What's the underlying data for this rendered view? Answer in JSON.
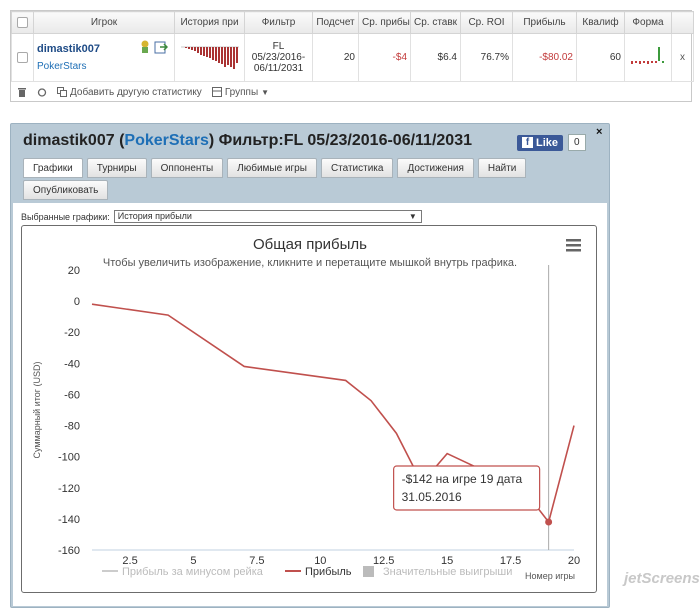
{
  "table": {
    "headers": [
      "Игрок",
      "История при",
      "Фильтр",
      "Подсчет",
      "Ср. прибы",
      "Ср. ставк",
      "Ср. ROI",
      "Прибыль",
      "Квалиф",
      "Форма"
    ],
    "row": {
      "player": "dimastik007",
      "site": "PokerStars",
      "filter_line1": "FL",
      "filter_line2": "05/23/2016-",
      "filter_line3": "06/11/2031",
      "count": "20",
      "avg_profit": "-$4",
      "avg_stake": "$6.4",
      "avg_roi": "76.7%",
      "profit": "-$80.02",
      "qualif": "60",
      "remove": "x"
    },
    "toolbar": {
      "add_stat": "Добавить другую статистику",
      "groups": "Группы"
    }
  },
  "profile": {
    "name": "dimastik007",
    "open_paren": "(",
    "site": "PokerStars",
    "filter": ") Фильтр:FL 05/23/2016-06/11/2031",
    "like_label": "Like",
    "like_count": "0",
    "close": "×",
    "tabs_row1": [
      "Графики",
      "Турниры",
      "Оппоненты",
      "Любимые игры",
      "Статистика",
      "Достижения",
      "Найти"
    ],
    "tabs_row2": [
      "Опубликовать"
    ],
    "chart_select_label": "Выбранные графики:",
    "chart_select_value": "История прибыли"
  },
  "chart_data": {
    "type": "line",
    "title": "Общая прибыль",
    "subtitle": "Чтобы увеличить изображение, кликните и перетащите мышкой внутрь графика.",
    "ylabel": "Суммарный итог (USD)",
    "xlabel": "Номер игры",
    "xlim": [
      1,
      20
    ],
    "ylim": [
      -160,
      20
    ],
    "x_ticks": [
      "2.5",
      "5",
      "7.5",
      "10",
      "12.5",
      "15",
      "17.5",
      "20"
    ],
    "y_ticks": [
      "20",
      "0",
      "-20",
      "-40",
      "-60",
      "-80",
      "-100",
      "-120",
      "-140",
      "-160"
    ],
    "series": [
      {
        "name": "Прибыль",
        "color": "#c0504d",
        "x": [
          1,
          4,
          7,
          11,
          12,
          13,
          14,
          15,
          18,
          19,
          20
        ],
        "y": [
          -2,
          -9,
          -42,
          -51,
          -64,
          -85,
          -117,
          -98,
          -121,
          -142,
          -80
        ]
      }
    ],
    "legend": [
      {
        "name": "Прибыль за минусом рейка",
        "color": "#cccccc",
        "marker": "line"
      },
      {
        "name": "Прибыль",
        "color": "#c0504d",
        "marker": "line"
      },
      {
        "name": "Значительные выигрыши",
        "color": "#bbbbbb",
        "marker": "square"
      }
    ],
    "tooltip": {
      "line1": "-$142 на игре 19 дата",
      "line2": "31.05.2016",
      "x": 19,
      "y": -142
    },
    "grid": false,
    "menu_icon": "hamburger-menu-icon"
  },
  "watermark": "jetScreenshot"
}
